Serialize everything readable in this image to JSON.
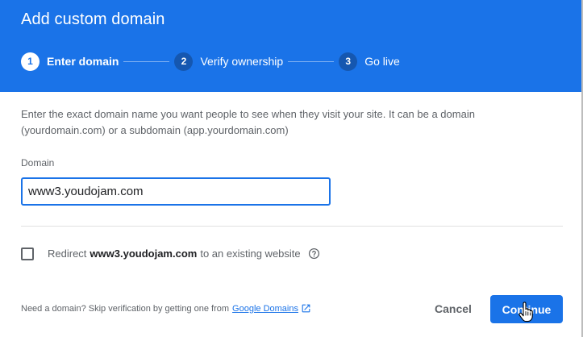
{
  "dialog": {
    "title": "Add custom domain"
  },
  "steps": [
    {
      "number": "1",
      "label": "Enter domain",
      "active": true
    },
    {
      "number": "2",
      "label": "Verify ownership",
      "active": false
    },
    {
      "number": "3",
      "label": "Go live",
      "active": false
    }
  ],
  "form": {
    "description": "Enter the exact domain name you want people to see when they visit your site. It can be a domain (yourdomain.com) or a subdomain (app.yourdomain.com)",
    "domain_label": "Domain",
    "domain_value": "www3.youdojam.com",
    "redirect_prefix": "Redirect",
    "redirect_domain": "www3.youdojam.com",
    "redirect_suffix": "to an existing website",
    "redirect_checked": false
  },
  "footer": {
    "note": "Need a domain? Skip verification by getting one from",
    "link_label": "Google Domains",
    "cancel_label": "Cancel",
    "continue_label": "Continue"
  },
  "colors": {
    "primary": "#1a73e8",
    "step_inactive": "#1557b0",
    "text_secondary": "#5f6368",
    "text_primary": "#202124"
  },
  "icons": {
    "help": "help-circle-icon",
    "external_link": "open-in-new-icon",
    "cursor": "hand-pointer-icon"
  }
}
